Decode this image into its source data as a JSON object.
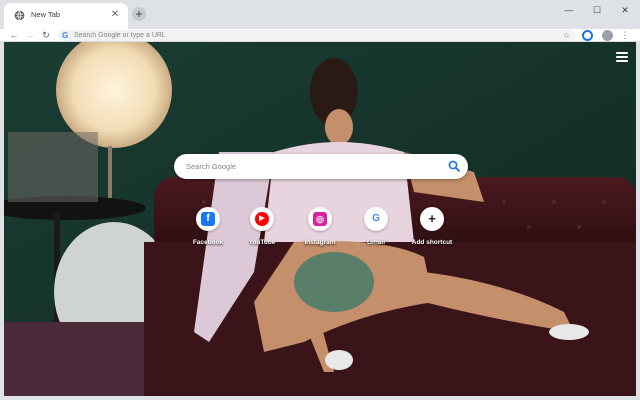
{
  "browser": {
    "tab": {
      "title": "New Tab",
      "close_glyph": "✕"
    },
    "new_tab_glyph": "+",
    "window_controls": {
      "minimize": "—",
      "maximize": "☐",
      "close": "✕"
    },
    "nav": {
      "back": "←",
      "forward": "→",
      "reload": "↻"
    },
    "omnibox": {
      "placeholder": "Search Google or type a URL",
      "star": "☆"
    },
    "menu_glyph": "⋮"
  },
  "new_tab_page": {
    "search": {
      "placeholder": "Search Google"
    },
    "shortcuts": [
      {
        "label": "Facebook",
        "icon": "facebook-icon",
        "color": "#1877f2",
        "glyph": "f"
      },
      {
        "label": "YouTube",
        "icon": "youtube-icon",
        "color": "#ff0000",
        "glyph": "▶"
      },
      {
        "label": "Instagram",
        "icon": "instagram-icon",
        "color": "#d6249f",
        "glyph": "◎"
      },
      {
        "label": "Gmail",
        "icon": "google-icon",
        "color": "#4285f4",
        "glyph": "G"
      },
      {
        "label": "Add shortcut",
        "icon": "plus-icon",
        "color": "#202124",
        "glyph": "+"
      }
    ]
  },
  "colors": {
    "tabstrip": "#dee1e6",
    "wallpaper_wall": "#16342c",
    "sofa": "#3a1418",
    "accent_blue": "#1a73e8"
  }
}
